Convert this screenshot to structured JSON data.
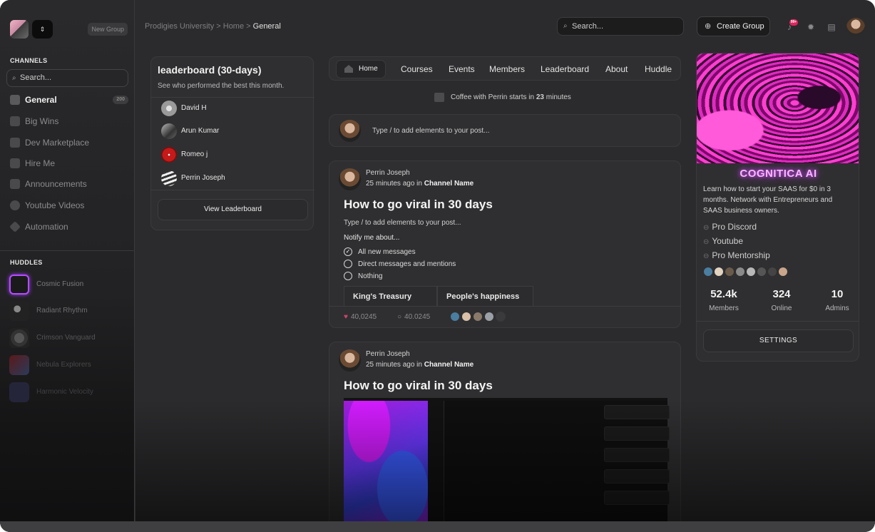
{
  "sidebar": {
    "new_group": "New Group",
    "channels_title": "CHANNELS",
    "search_placeholder": "Search...",
    "channels": [
      {
        "label": "General",
        "count": "200",
        "active": true
      },
      {
        "label": "Big Wins"
      },
      {
        "label": "Dev Marketplace"
      },
      {
        "label": "Hire Me"
      },
      {
        "label": "Announcements"
      },
      {
        "label": "Youtube Videos"
      },
      {
        "label": "Automation"
      }
    ],
    "huddles_title": "HUDDLES",
    "huddles": [
      {
        "label": "Cosmic Fusion"
      },
      {
        "label": "Radiant Rhythm"
      },
      {
        "label": "Crimson Vanguard"
      },
      {
        "label": "Nebula Explorers"
      },
      {
        "label": "Harmonic Velocity"
      }
    ]
  },
  "topbar": {
    "breadcrumb": [
      "Prodigies University",
      "Home",
      "General"
    ],
    "search_placeholder": "Search...",
    "create_group": "Create Group",
    "notif_badge": "99+"
  },
  "leaderboard": {
    "title": "leaderboard (30-days)",
    "subtitle": "See who performed the best this month.",
    "members": [
      "David H",
      "Arun Kumar",
      "Romeo j",
      "Perrin Joseph"
    ],
    "button": "View Leaderboard"
  },
  "nav": {
    "tabs": [
      "Home",
      "Courses",
      "Events",
      "Members",
      "Leaderboard",
      "About",
      "Huddle"
    ]
  },
  "event": {
    "prefix": "Coffee with Perrin starts in ",
    "minutes": "23",
    "suffix": " minutes"
  },
  "composer": {
    "placeholder": "Type / to add elements to your post..."
  },
  "posts": [
    {
      "author": "Perrin Joseph",
      "time": "25 minutes ago in ",
      "channel": "Channel Name",
      "title": "How to go viral in 30 days",
      "body": "Type / to add elements to your post...",
      "notify_label": "Notify me about...",
      "options": [
        "All new messages",
        "Direct messages and mentions",
        "Nothing"
      ],
      "tabs": [
        "King's Treasury",
        "People's happiness"
      ],
      "likes": "40,0245",
      "comments": "40.0245"
    },
    {
      "author": "Perrin Joseph",
      "time": "25 minutes ago in ",
      "channel": "Channel Name",
      "title": "How to go viral in 30 days"
    }
  ],
  "group": {
    "name": "COGNITICA AI",
    "description": "Learn how to start your SAAS for $0 in 3 months. Network with Entrepreneurs and SAAS business owners.",
    "links": [
      "Pro Discord",
      "Youtube",
      "Pro Mentorship"
    ],
    "stats": [
      {
        "value": "52.4k",
        "label": "Members"
      },
      {
        "value": "324",
        "label": "Online"
      },
      {
        "value": "10",
        "label": "Admins"
      }
    ],
    "settings": "SETTINGS"
  },
  "colors": {
    "accent_pink": "#e02bbf",
    "like_red": "#d1446b",
    "badge_red": "#e0245e"
  }
}
